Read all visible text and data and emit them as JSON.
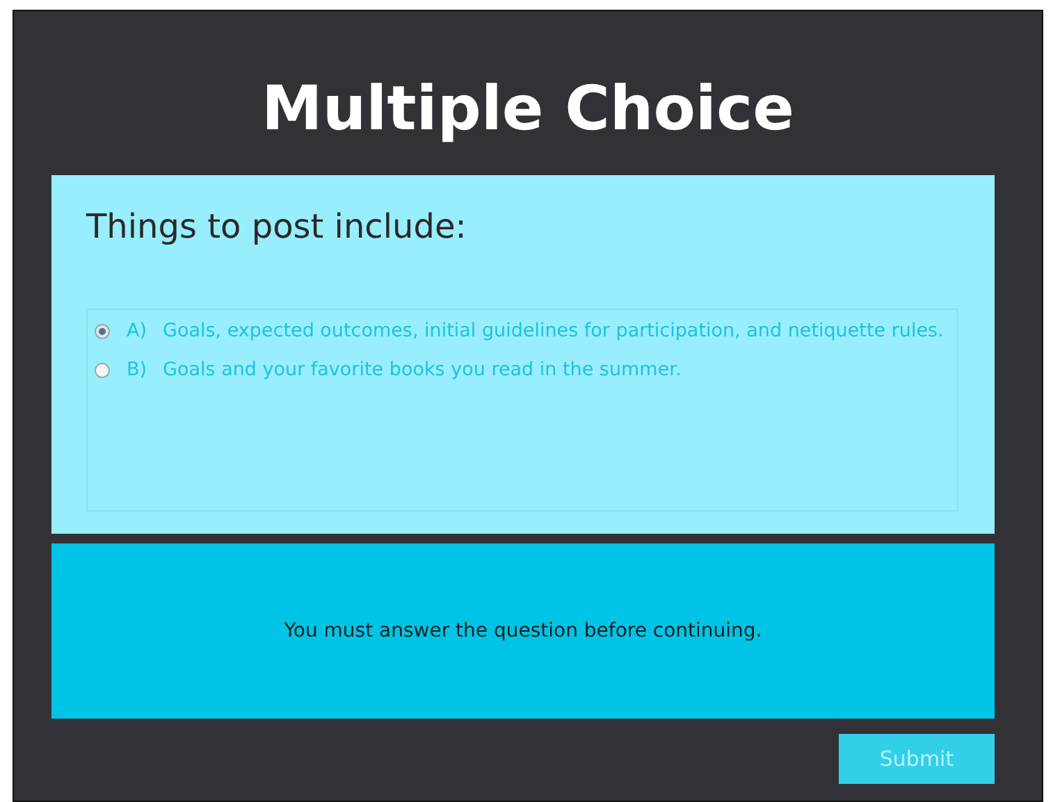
{
  "title": "Multiple Choice",
  "question": "Things to post include:",
  "options": [
    {
      "letter": "A)",
      "text": "Goals, expected outcomes, initial guidelines for participation, and netiquette rules.",
      "selected": true
    },
    {
      "letter": "B)",
      "text": "Goals and your favorite books you read in the summer.",
      "selected": false
    }
  ],
  "feedback": "You must answer the question before continuing.",
  "submit": "Submit"
}
